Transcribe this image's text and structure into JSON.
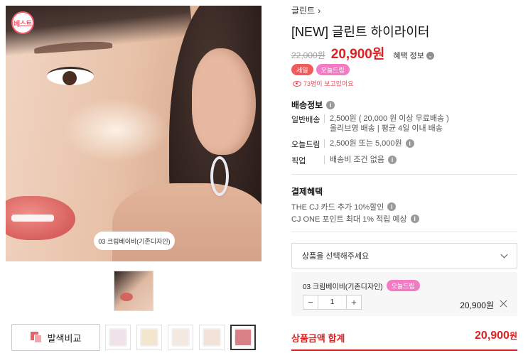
{
  "gallery": {
    "best_badge": "베스트",
    "shade_caption": "03 크림베이비(기존디자인)",
    "compare_button": "발색비교",
    "swatch_colors": [
      "#efe3e9",
      "#f2e6cf",
      "#f4e9e1",
      "#f3e2da",
      "#d97f86"
    ]
  },
  "product": {
    "brand": "글린트",
    "brand_chevron": "›",
    "title": "[NEW] 글린트 하이라이터",
    "original_price": "22,000원",
    "sale_price": "20,900원",
    "benefit_label": "혜택 정보",
    "flags": [
      "세일",
      "오늘드림"
    ],
    "viewers": "73명이 보고있어요"
  },
  "shipping": {
    "title": "배송정보",
    "rows": [
      {
        "label": "일반배송",
        "lines": [
          "2,500원 ( 20,000 원 이상 무료배송 )",
          "올리브영 배송  |  평균 4일 이내 배송"
        ]
      },
      {
        "label": "오늘드림",
        "lines": [
          "2,500원 또는 5,000원"
        ]
      },
      {
        "label": "픽업",
        "lines": [
          "배송비 조건 없음"
        ]
      }
    ]
  },
  "payment": {
    "title": "결제혜택",
    "lines": [
      "THE CJ 카드 추가 10%할인",
      "CJ ONE 포인트 최대 1% 적립 예상"
    ]
  },
  "order": {
    "select_placeholder": "상품을 선택해주세요",
    "option_name": "03 크림베이비(기존디자인)",
    "option_flag": "오늘드림",
    "quantity": "1",
    "minus": "−",
    "plus": "+",
    "option_price": "20,900원",
    "total_label": "상품금액 합계",
    "total_amount": "20,900",
    "total_unit": "원"
  },
  "colors": {
    "accent_red": "#e02020",
    "today_pink": "#f27bc4",
    "sale_red": "#f35b5b"
  }
}
